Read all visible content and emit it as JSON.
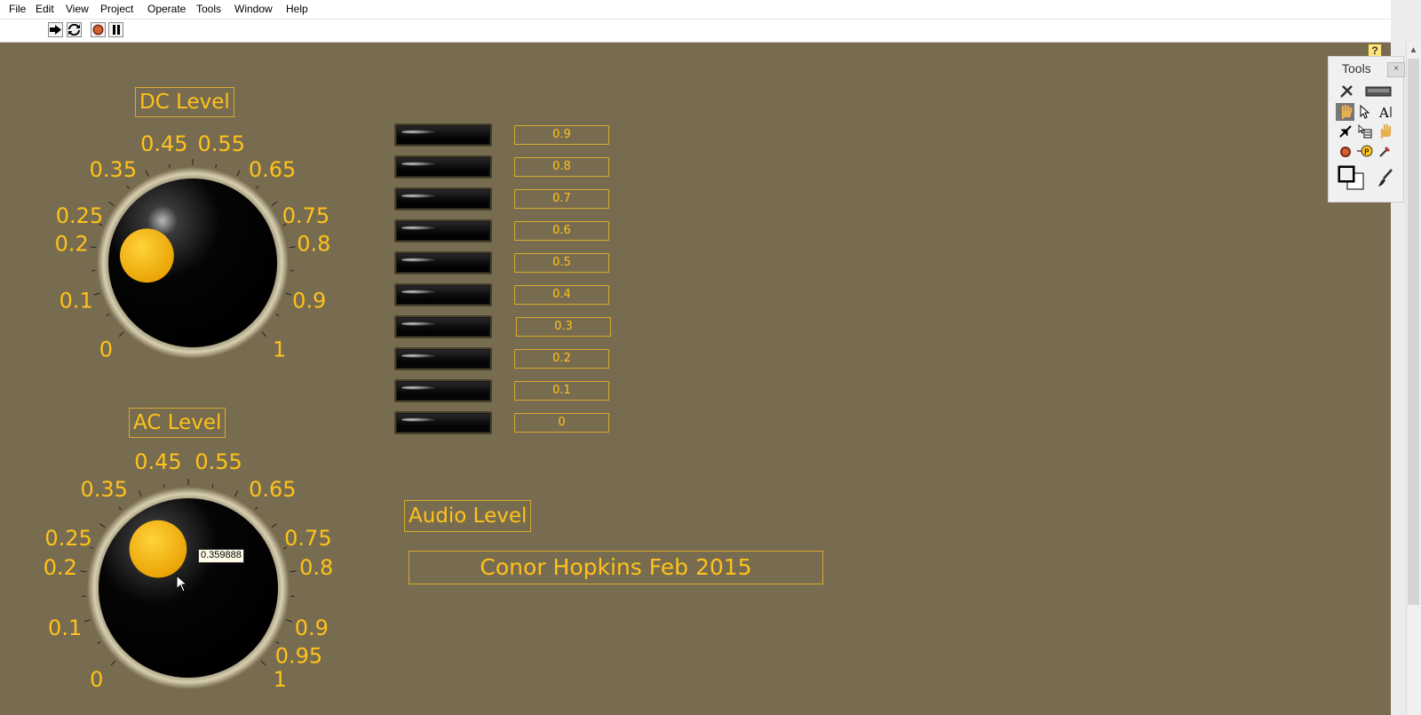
{
  "menu": [
    "File",
    "Edit",
    "View",
    "Project",
    "Operate",
    "Tools",
    "Window",
    "Help"
  ],
  "toolbar": {
    "run_icon": "run-arrow-icon",
    "run_continuous_icon": "run-continuously-icon",
    "abort_icon": "abort-stop-icon",
    "pause_icon": "pause-icon",
    "help_label": "?"
  },
  "dc_knob": {
    "label": "DC Level",
    "value": 0.2,
    "scale": [
      "0",
      "0.1",
      "0.2",
      "0.25",
      "0.35",
      "0.45",
      "0.55",
      "0.65",
      "0.75",
      "0.8",
      "0.9",
      "1"
    ]
  },
  "ac_knob": {
    "label": "AC Level",
    "value": 0.359888,
    "tooltip": "0.359888",
    "scale": [
      "0",
      "0.1",
      "0.2",
      "0.25",
      "0.35",
      "0.45",
      "0.55",
      "0.65",
      "0.75",
      "0.8",
      "0.9",
      "0.95",
      "1"
    ]
  },
  "meter": {
    "levels": [
      "0.9",
      "0.8",
      "0.7",
      "0.6",
      "0.5",
      "0.4",
      "0.3",
      "0.2",
      "0.1",
      "0"
    ],
    "lit": [
      false,
      false,
      false,
      false,
      false,
      false,
      false,
      false,
      false,
      false
    ]
  },
  "audio_level_label": "Audio Level",
  "author_text": "Conor Hopkins Feb 2015",
  "tools_palette": {
    "title": "Tools",
    "close": "×",
    "icons": [
      "auto-tool-icon",
      "auto-tool-led-icon",
      "operate-hand-icon",
      "position-arrow-icon",
      "edit-text-icon",
      "connect-wire-icon",
      "shortcut-menu-icon",
      "scroll-hand-icon",
      "breakpoint-icon",
      "probe-icon",
      "color-copy-icon",
      "set-color-icon",
      "paint-brush-icon"
    ]
  },
  "colors": {
    "panel_bg": "#786c50",
    "accent": "#ffc21a",
    "label_border": "#d8a92b"
  }
}
